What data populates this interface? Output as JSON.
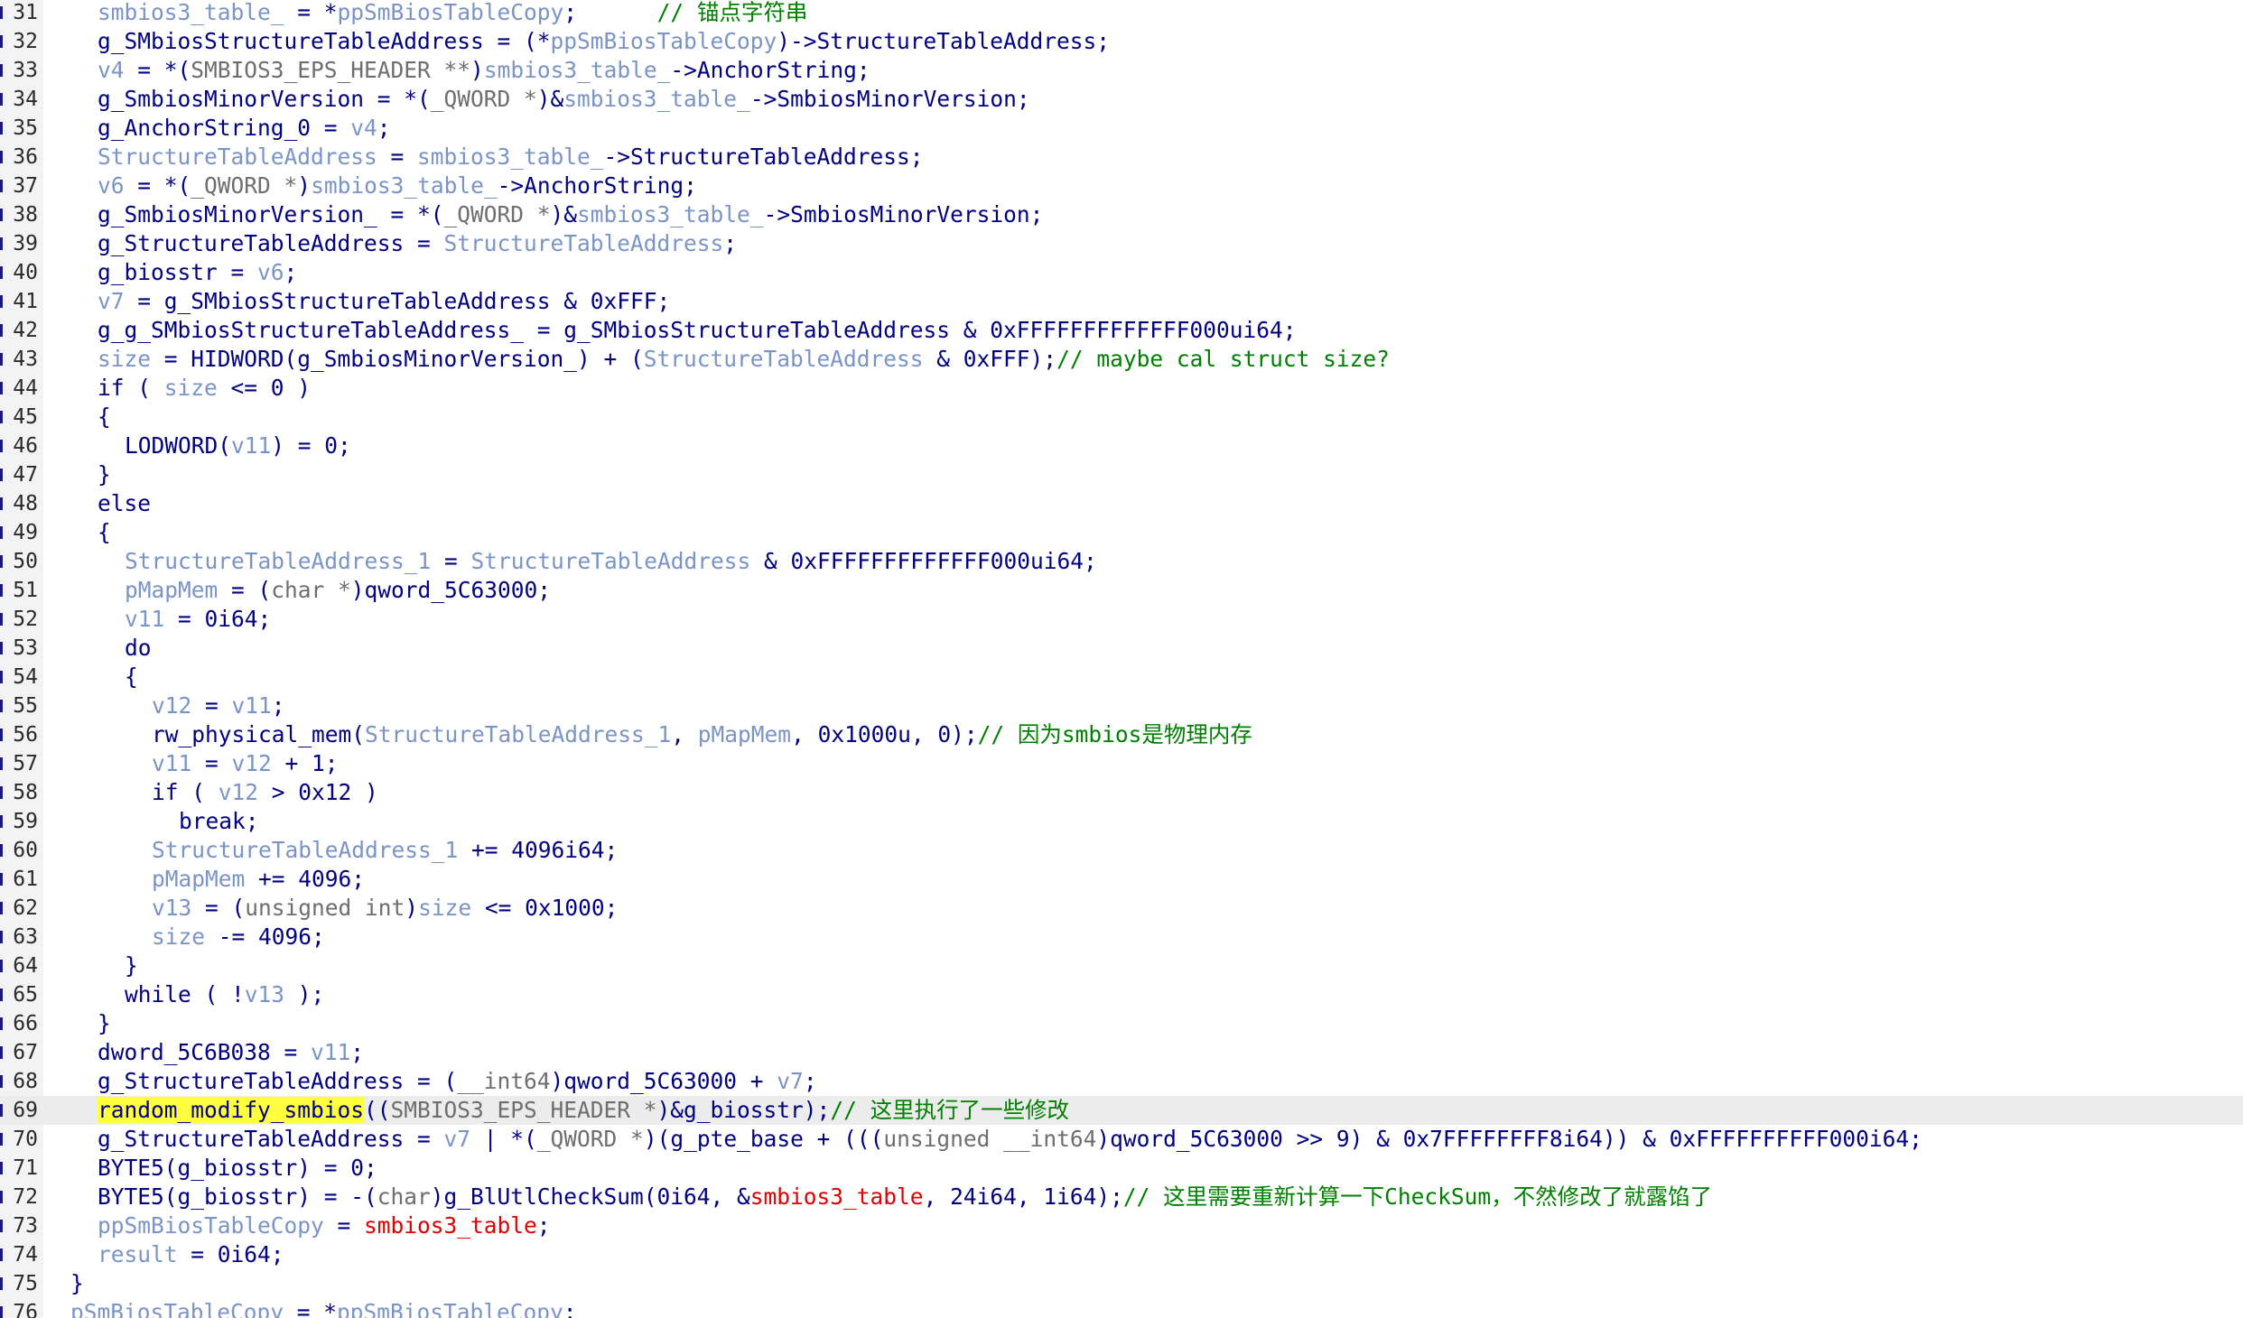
{
  "editor": {
    "current_line": 69,
    "colors": {
      "default": "#000080",
      "local_variable": "#7a94c8",
      "type": "#6e6e6e",
      "string_data": "#e00000",
      "comment": "#008000",
      "highlight": "#ffff3c",
      "current_line_bg": "#ececec"
    }
  },
  "lines": [
    {
      "n": "31",
      "indent": 3,
      "tokens": [
        [
          "v",
          "smbios3_table_"
        ],
        [
          "g",
          " = *"
        ],
        [
          "v",
          "ppSmBiosTableCopy"
        ],
        [
          "g",
          ";      "
        ],
        [
          "c",
          "// 锚点字符串"
        ]
      ]
    },
    {
      "n": "32",
      "indent": 3,
      "tokens": [
        [
          "g",
          "g_SMbiosStructureTableAddress = (*"
        ],
        [
          "v",
          "ppSmBiosTableCopy"
        ],
        [
          "g",
          ")->StructureTableAddress;"
        ]
      ]
    },
    {
      "n": "33",
      "indent": 3,
      "tokens": [
        [
          "v",
          "v4"
        ],
        [
          "g",
          " = *("
        ],
        [
          "t",
          "SMBIOS3_EPS_HEADER **"
        ],
        [
          "g",
          ")"
        ],
        [
          "v",
          "smbios3_table_"
        ],
        [
          "g",
          "->AnchorString;"
        ]
      ]
    },
    {
      "n": "34",
      "indent": 3,
      "tokens": [
        [
          "g",
          "g_SmbiosMinorVersion = *("
        ],
        [
          "t",
          "_QWORD *"
        ],
        [
          "g",
          ")&"
        ],
        [
          "v",
          "smbios3_table_"
        ],
        [
          "g",
          "->SmbiosMinorVersion;"
        ]
      ]
    },
    {
      "n": "35",
      "indent": 3,
      "tokens": [
        [
          "g",
          "g_AnchorString_0 = "
        ],
        [
          "v",
          "v4"
        ],
        [
          "g",
          ";"
        ]
      ]
    },
    {
      "n": "36",
      "indent": 3,
      "tokens": [
        [
          "v",
          "StructureTableAddress"
        ],
        [
          "g",
          " = "
        ],
        [
          "v",
          "smbios3_table_"
        ],
        [
          "g",
          "->StructureTableAddress;"
        ]
      ]
    },
    {
      "n": "37",
      "indent": 3,
      "tokens": [
        [
          "v",
          "v6"
        ],
        [
          "g",
          " = *("
        ],
        [
          "t",
          "_QWORD *"
        ],
        [
          "g",
          ")"
        ],
        [
          "v",
          "smbios3_table_"
        ],
        [
          "g",
          "->AnchorString;"
        ]
      ]
    },
    {
      "n": "38",
      "indent": 3,
      "tokens": [
        [
          "g",
          "g_SmbiosMinorVersion_ = *("
        ],
        [
          "t",
          "_QWORD *"
        ],
        [
          "g",
          ")&"
        ],
        [
          "v",
          "smbios3_table_"
        ],
        [
          "g",
          "->SmbiosMinorVersion;"
        ]
      ]
    },
    {
      "n": "39",
      "indent": 3,
      "tokens": [
        [
          "g",
          "g_StructureTableAddress = "
        ],
        [
          "v",
          "StructureTableAddress"
        ],
        [
          "g",
          ";"
        ]
      ]
    },
    {
      "n": "40",
      "indent": 3,
      "tokens": [
        [
          "g",
          "g_biosstr = "
        ],
        [
          "v",
          "v6"
        ],
        [
          "g",
          ";"
        ]
      ]
    },
    {
      "n": "41",
      "indent": 3,
      "tokens": [
        [
          "v",
          "v7"
        ],
        [
          "g",
          " = g_SMbiosStructureTableAddress & 0xFFF;"
        ]
      ]
    },
    {
      "n": "42",
      "indent": 3,
      "tokens": [
        [
          "g",
          "g_g_SMbiosStructureTableAddress_ = g_SMbiosStructureTableAddress & 0xFFFFFFFFFFFFF000ui64;"
        ]
      ]
    },
    {
      "n": "43",
      "indent": 3,
      "tokens": [
        [
          "v",
          "size"
        ],
        [
          "g",
          " = HIDWORD(g_SmbiosMinorVersion_) + ("
        ],
        [
          "v",
          "StructureTableAddress"
        ],
        [
          "g",
          " & 0xFFF);"
        ],
        [
          "c",
          "// maybe cal struct size?"
        ]
      ]
    },
    {
      "n": "44",
      "indent": 3,
      "tokens": [
        [
          "g",
          "if ( "
        ],
        [
          "v",
          "size"
        ],
        [
          "g",
          " <= 0 )"
        ]
      ]
    },
    {
      "n": "45",
      "indent": 3,
      "tokens": [
        [
          "g",
          "{"
        ]
      ]
    },
    {
      "n": "46",
      "indent": 4,
      "tokens": [
        [
          "g",
          "LODWORD("
        ],
        [
          "v",
          "v11"
        ],
        [
          "g",
          ") = 0;"
        ]
      ]
    },
    {
      "n": "47",
      "indent": 3,
      "tokens": [
        [
          "g",
          "}"
        ]
      ]
    },
    {
      "n": "48",
      "indent": 3,
      "tokens": [
        [
          "g",
          "else"
        ]
      ]
    },
    {
      "n": "49",
      "indent": 3,
      "tokens": [
        [
          "g",
          "{"
        ]
      ]
    },
    {
      "n": "50",
      "indent": 4,
      "tokens": [
        [
          "v",
          "StructureTableAddress_1"
        ],
        [
          "g",
          " = "
        ],
        [
          "v",
          "StructureTableAddress"
        ],
        [
          "g",
          " & 0xFFFFFFFFFFFFF000ui64;"
        ]
      ]
    },
    {
      "n": "51",
      "indent": 4,
      "tokens": [
        [
          "v",
          "pMapMem"
        ],
        [
          "g",
          " = ("
        ],
        [
          "t",
          "char *"
        ],
        [
          "g",
          ")qword_5C63000;"
        ]
      ]
    },
    {
      "n": "52",
      "indent": 4,
      "tokens": [
        [
          "v",
          "v11"
        ],
        [
          "g",
          " = 0i64;"
        ]
      ]
    },
    {
      "n": "53",
      "indent": 4,
      "tokens": [
        [
          "g",
          "do"
        ]
      ]
    },
    {
      "n": "54",
      "indent": 4,
      "tokens": [
        [
          "g",
          "{"
        ]
      ]
    },
    {
      "n": "55",
      "indent": 5,
      "tokens": [
        [
          "v",
          "v12"
        ],
        [
          "g",
          " = "
        ],
        [
          "v",
          "v11"
        ],
        [
          "g",
          ";"
        ]
      ]
    },
    {
      "n": "56",
      "indent": 5,
      "tokens": [
        [
          "g",
          "rw_physical_mem("
        ],
        [
          "v",
          "StructureTableAddress_1"
        ],
        [
          "g",
          ", "
        ],
        [
          "v",
          "pMapMem"
        ],
        [
          "g",
          ", 0x1000u, 0);"
        ],
        [
          "c",
          "// 因为smbios是物理内存"
        ]
      ]
    },
    {
      "n": "57",
      "indent": 5,
      "tokens": [
        [
          "v",
          "v11"
        ],
        [
          "g",
          " = "
        ],
        [
          "v",
          "v12"
        ],
        [
          "g",
          " + 1;"
        ]
      ]
    },
    {
      "n": "58",
      "indent": 5,
      "tokens": [
        [
          "g",
          "if ( "
        ],
        [
          "v",
          "v12"
        ],
        [
          "g",
          " > 0x12 )"
        ]
      ]
    },
    {
      "n": "59",
      "indent": 6,
      "tokens": [
        [
          "g",
          "break;"
        ]
      ]
    },
    {
      "n": "60",
      "indent": 5,
      "tokens": [
        [
          "v",
          "StructureTableAddress_1"
        ],
        [
          "g",
          " += 4096i64;"
        ]
      ]
    },
    {
      "n": "61",
      "indent": 5,
      "tokens": [
        [
          "v",
          "pMapMem"
        ],
        [
          "g",
          " += 4096;"
        ]
      ]
    },
    {
      "n": "62",
      "indent": 5,
      "tokens": [
        [
          "v",
          "v13"
        ],
        [
          "g",
          " = ("
        ],
        [
          "t",
          "unsigned int"
        ],
        [
          "g",
          ")"
        ],
        [
          "v",
          "size"
        ],
        [
          "g",
          " <= 0x1000;"
        ]
      ]
    },
    {
      "n": "63",
      "indent": 5,
      "tokens": [
        [
          "v",
          "size"
        ],
        [
          "g",
          " -= 4096;"
        ]
      ]
    },
    {
      "n": "64",
      "indent": 4,
      "tokens": [
        [
          "g",
          "}"
        ]
      ]
    },
    {
      "n": "65",
      "indent": 4,
      "tokens": [
        [
          "g",
          "while ( !"
        ],
        [
          "v",
          "v13"
        ],
        [
          "g",
          " );"
        ]
      ]
    },
    {
      "n": "66",
      "indent": 3,
      "tokens": [
        [
          "g",
          "}"
        ]
      ]
    },
    {
      "n": "67",
      "indent": 3,
      "tokens": [
        [
          "g",
          "dword_5C6B038 = "
        ],
        [
          "v",
          "v11"
        ],
        [
          "g",
          ";"
        ]
      ]
    },
    {
      "n": "68",
      "indent": 3,
      "tokens": [
        [
          "g",
          "g_StructureTableAddress = ("
        ],
        [
          "t",
          "__int64"
        ],
        [
          "g",
          ")qword_5C63000 + "
        ],
        [
          "v",
          "v7"
        ],
        [
          "g",
          ";"
        ]
      ]
    },
    {
      "n": "69",
      "indent": 3,
      "tokens": [
        [
          "h",
          "random_modify_smbios"
        ],
        [
          "g",
          "(("
        ],
        [
          "t",
          "SMBIOS3_EPS_HEADER *"
        ],
        [
          "g",
          ")&g_biosstr);"
        ],
        [
          "c",
          "// 这里执行了一些修改"
        ]
      ]
    },
    {
      "n": "70",
      "indent": 3,
      "tokens": [
        [
          "g",
          "g_StructureTableAddress = "
        ],
        [
          "v",
          "v7"
        ],
        [
          "g",
          " | *("
        ],
        [
          "t",
          "_QWORD *"
        ],
        [
          "g",
          ")(g_pte_base + ((("
        ],
        [
          "t",
          "unsigned __int64"
        ],
        [
          "g",
          ")qword_5C63000 >> 9) & 0x7FFFFFFFF8i64)) & 0xFFFFFFFFFF000i64;"
        ]
      ]
    },
    {
      "n": "71",
      "indent": 3,
      "tokens": [
        [
          "g",
          "BYTE5(g_biosstr) = 0;"
        ]
      ]
    },
    {
      "n": "72",
      "indent": 3,
      "tokens": [
        [
          "g",
          "BYTE5(g_biosstr) = -("
        ],
        [
          "t",
          "char"
        ],
        [
          "g",
          ")g_BlUtlCheckSum(0i64, &"
        ],
        [
          "s",
          "smbios3_table"
        ],
        [
          "g",
          ", 24i64, 1i64);"
        ],
        [
          "c",
          "// 这里需要重新计算一下CheckSum，不然修改了就露馅了"
        ]
      ]
    },
    {
      "n": "73",
      "indent": 3,
      "tokens": [
        [
          "v",
          "ppSmBiosTableCopy"
        ],
        [
          "g",
          " = "
        ],
        [
          "s",
          "smbios3_table"
        ],
        [
          "g",
          ";"
        ]
      ]
    },
    {
      "n": "74",
      "indent": 3,
      "tokens": [
        [
          "v",
          "result"
        ],
        [
          "g",
          " = 0i64;"
        ]
      ]
    },
    {
      "n": "75",
      "indent": 2,
      "tokens": [
        [
          "g",
          "}"
        ]
      ]
    },
    {
      "n": "76",
      "indent": 2,
      "tokens": [
        [
          "v",
          "pSmBiosTableCopy"
        ],
        [
          "g",
          " = *"
        ],
        [
          "v",
          "ppSmBiosTableCopy"
        ],
        [
          "g",
          ";"
        ]
      ]
    }
  ]
}
